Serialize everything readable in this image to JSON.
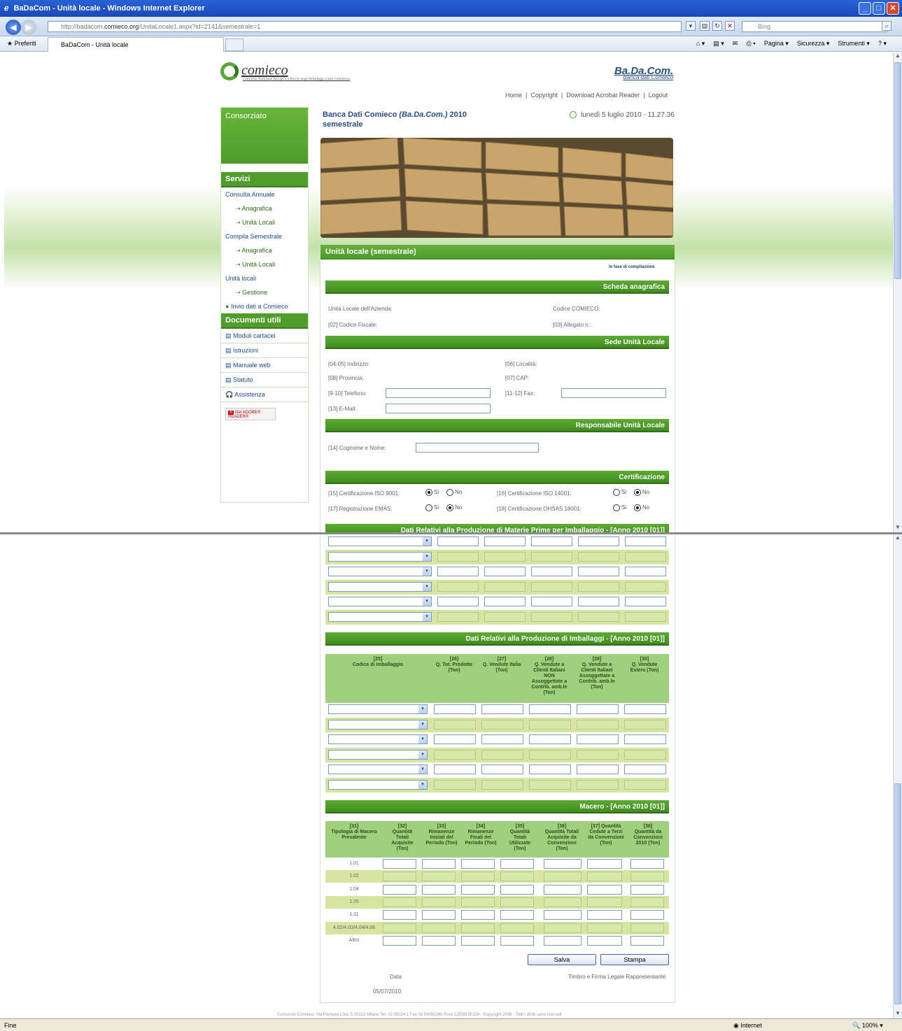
{
  "browser": {
    "title": "BaDaCom - Unità locale - Windows Internet Explorer",
    "url_prefix": "http://badacom.",
    "url_domain": "comieco.org",
    "url_rest": "/UnitaLocale1.aspx?id=2141&semestrale=1",
    "search_placeholder": "Bing",
    "favorites_label": "Preferiti",
    "tab_label": "BaDaCom - Unità locale",
    "cmd_page": "Pagina ▾",
    "cmd_security": "Sicurezza ▾",
    "cmd_tools": "Strumenti ▾",
    "status_left": "Fine",
    "status_zone": "Internet",
    "status_zoom": "100%"
  },
  "header": {
    "logo_text": "comieco",
    "logo_tagline": "Consorzio Nazionale Recupero e Riciclo degli Imballaggi a base Cellulosica",
    "bada_title": "Ba.Da.Com.",
    "bada_subtitle": "Banca dati Comieco",
    "nav": [
      "Home",
      "Copyright",
      "Download Acrobat Reader",
      "Logout"
    ],
    "page_title_a": "Banca Dati Comieco ",
    "page_title_i": "(Ba.Da.Com.)",
    "page_title_b": " 2010 semestrale",
    "datetime": "lunedì 5 luglio 2010 - 11.27.36"
  },
  "sidebar": {
    "consorziato": "Consorziato",
    "servizi": "Servizi",
    "consulta": "Consulta Annuale",
    "anagrafica1": "Anagrafica",
    "unita1": "Unità Locali",
    "compila": "Compila Semestrale",
    "anagrafica2": "Anagrafica",
    "unita2": "Unità Locali",
    "unita_locali": "Unità locali",
    "gestione": "Gestione",
    "invio": "Invio dati a Comieco",
    "documenti": "Documenti utili",
    "moduli": "Moduli cartacei",
    "istruzioni": "Istruzioni",
    "manuale": "Manuale web",
    "statuto": "Statuto",
    "assistenza": "Assistenza",
    "adobe": "Get ADOBE® READER®"
  },
  "form": {
    "panel_title": "Unità locale (semestrale)",
    "status": "In fase di compilazione",
    "scheda": "Scheda anagrafica",
    "unita_azienda": "Unità Locale dell'Azienda:",
    "codice_comieco": "Codice COMIECO:",
    "codice_fiscale": "[02] Codice Fiscale:",
    "allegato": "[03] Allegato n.:",
    "sede": "Sede Unità Locale",
    "indirizzo": "[04-05] Indirizzo:",
    "localita": "[06] Località:",
    "provincia": "[08] Provincia:",
    "cap": "[07] CAP:",
    "telefono": "[9-10] Telefono:",
    "fax": "[11-12] Fax:",
    "email": "[13] E-Mail:",
    "responsabile": "Responsabile Unità Locale",
    "cognome": "[14] Cognome e Nome:",
    "certificazione": "Certificazione",
    "iso9001": "[15] Certificazione ISO 9001:",
    "iso14001": "[16] Certificazione ISO 14001:",
    "emas": "[17] Registrazione EMAS:",
    "ohsas": "[18] Certificazione OHSAS 18001:",
    "si": "Si",
    "no": "No",
    "materie_prime": "Dati Relativi alla Produzione di Materie Prime per Imballaggio - [Anno 2010 [01]]"
  },
  "imballaggi": {
    "title": "Dati Relativi alla Produzione di Imballaggi - [Anno 2010 [01]]",
    "headers": [
      "[25]\nCodice di Imballaggio",
      "[26]\nQ. Tot. Prodotte\n(Ton)",
      "[27]\nQ. Vendute Italia\n(Ton)",
      "[28]\nQ. Vendute a\nClienti Italiani\nNON\nAssoggettate a\nContrib. amb.le\n(Ton)",
      "[29]\nQ. Vendute a\nClienti Italiani\nAssoggettate a\nContrib. amb.le\n(Ton)",
      "[30]\nQ. Vendute\nEstero (Ton)"
    ]
  },
  "macero": {
    "title": "Macero - [Anno 2010 [01]]",
    "headers": [
      "[31]\nTipologia di Macero\nPrevalente",
      "[32]\nQuantità\nTotali\nAcquisite\n(Ton)",
      "[33]\nRimanenze\nIniziali del\nPeriodo (Ton)",
      "[34]\nRimanenze\nFinali del\nPeriodo (Ton)",
      "[35]\nQuantità\nTotali\nUtilizzate\n(Ton)",
      "[36]\nQuantità Totali\nAcquisite da\nConvenzioni\n(Ton)",
      "[37] Quantità\nCedute a Terzi\nda Convenzioni\n(Ton)",
      "[38]\nQuantità da\nConvenzioni\n2010 (Ton)"
    ],
    "categories": [
      "1.01",
      "1.02",
      "1.04",
      "1.05",
      "1.11",
      "4.02/4.03/4.04/4.06",
      "Altro"
    ],
    "save": "Salva",
    "print": "Stampa",
    "data_label": "Data",
    "firma": "Timbro e Firma Legale Rappresentante",
    "date": "05/07/2010",
    "footer": "Consorzio Comieco: Via Pompeo Litta, 5 20122 Milano Tel. 02 55024.1 Fax 02 54050240 P.iva 12559150159 - Copyright 2008 - Tutti i diritti sono riservati"
  }
}
